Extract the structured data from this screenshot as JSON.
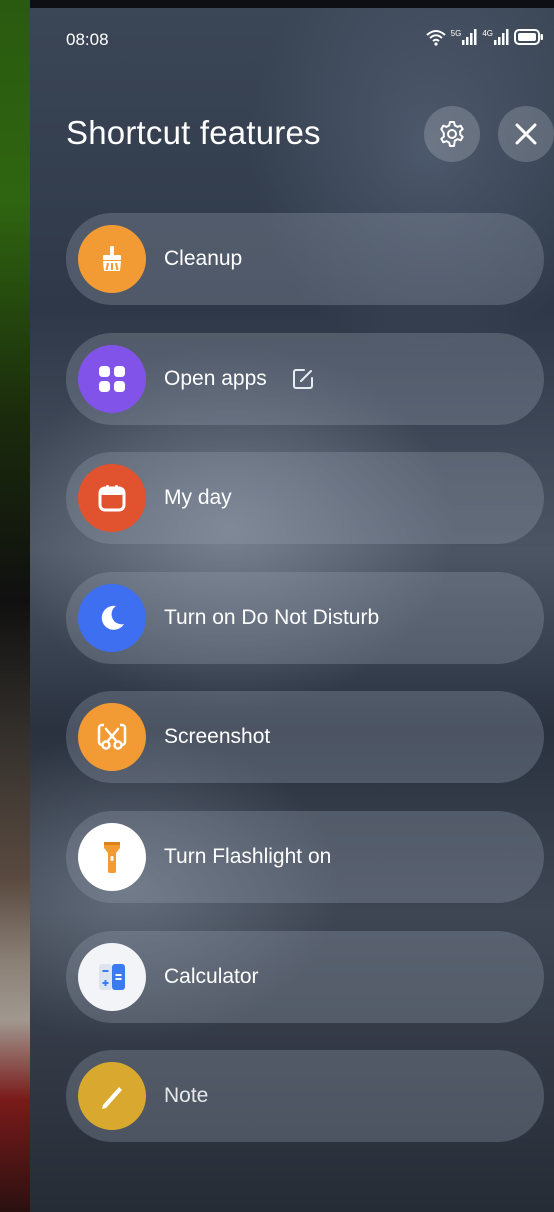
{
  "status_bar": {
    "time": "08:08",
    "network_5g": "5G",
    "network_4g": "4G"
  },
  "header": {
    "title": "Shortcut features"
  },
  "shortcuts": [
    {
      "label": "Cleanup",
      "icon": "broom-icon",
      "color": "#F29A33"
    },
    {
      "label": "Open apps",
      "icon": "grid-icon",
      "color": "#8153E8"
    },
    {
      "label": "My day",
      "icon": "calendar-icon",
      "color": "#E0532E"
    },
    {
      "label": "Turn on Do Not Disturb",
      "icon": "moon-icon",
      "color": "#3E6FF0"
    },
    {
      "label": "Screenshot",
      "icon": "scissors-icon",
      "color": "#F29A33"
    },
    {
      "label": "Turn Flashlight on",
      "icon": "flashlight-icon",
      "color": "#FFFFFF"
    },
    {
      "label": "Calculator",
      "icon": "calculator-icon",
      "color": "#F2F4F7"
    },
    {
      "label": "Note",
      "icon": "pencil-icon",
      "color": "#D9A82E"
    }
  ]
}
